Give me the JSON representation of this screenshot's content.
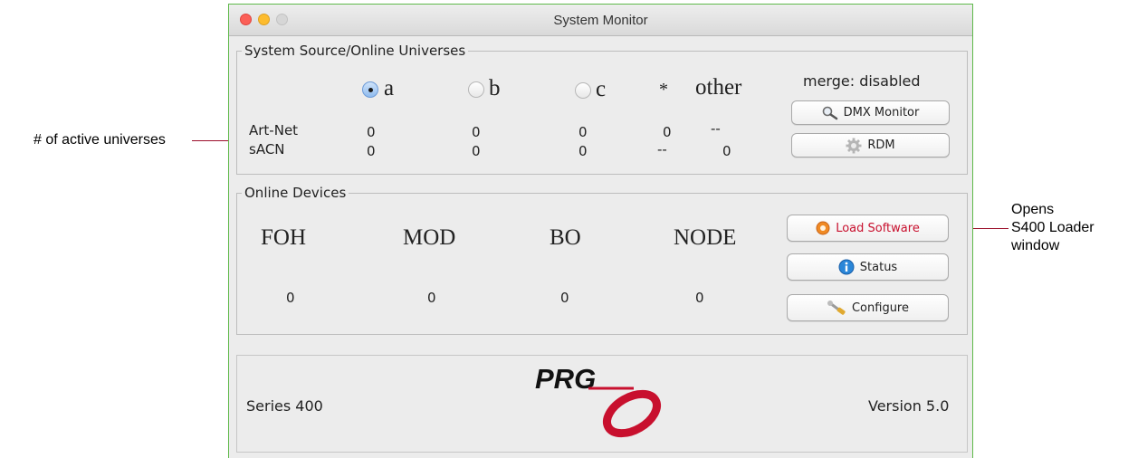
{
  "annotations": {
    "active_universes": "# of active universes",
    "opens_line1": "Opens",
    "opens_line2": "S400 Loader",
    "opens_line3": "window"
  },
  "window": {
    "title": "System Monitor"
  },
  "universes": {
    "panel_title": "System Source/Online Universes",
    "sources": [
      {
        "label": "a",
        "selected": true
      },
      {
        "label": "b",
        "selected": false
      },
      {
        "label": "c",
        "selected": false
      }
    ],
    "star": "*",
    "other": "other",
    "merge_status": "merge: disabled",
    "rows": [
      {
        "label": "Art-Net",
        "values": [
          "0",
          "0",
          "0",
          "0",
          "--"
        ]
      },
      {
        "label": "sACN",
        "values": [
          "0",
          "0",
          "0",
          "--",
          "0"
        ]
      }
    ],
    "dmx_monitor_label": "DMX Monitor",
    "rdm_label": "RDM"
  },
  "devices": {
    "panel_title": "Online Devices",
    "columns": [
      {
        "name": "FOH",
        "count": "0"
      },
      {
        "name": "MOD",
        "count": "0"
      },
      {
        "name": "BO",
        "count": "0"
      },
      {
        "name": "NODE",
        "count": "0"
      }
    ],
    "load_software_label": "Load Software",
    "status_label": "Status",
    "configure_label": "Configure"
  },
  "footer": {
    "series": "Series 400",
    "logo_text": "PRG",
    "version": "Version 5.0"
  },
  "colors": {
    "load_software_text": "#c8102e",
    "logo_red": "#c8102e",
    "window_border": "#5fb94a"
  },
  "icons": [
    "magnifier-icon",
    "gear-icon",
    "orange-circle-icon",
    "info-icon",
    "wrench-icon",
    "prg-logo"
  ]
}
